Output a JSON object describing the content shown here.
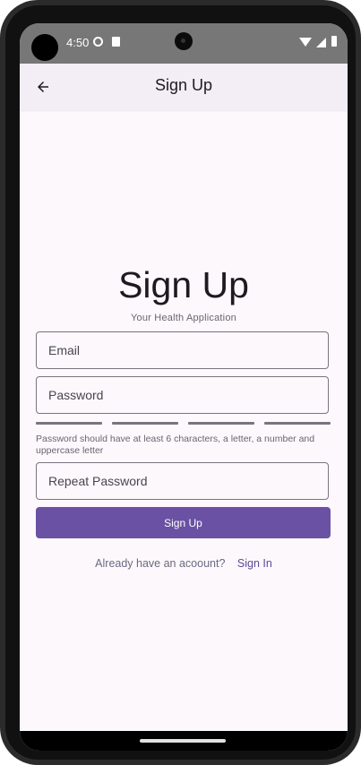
{
  "status_bar": {
    "time": "4:50",
    "icons": [
      "settings-icon",
      "sd-card-icon",
      "wifi-icon",
      "signal-icon",
      "battery-icon"
    ]
  },
  "app_bar": {
    "back_icon": "arrow-back-icon",
    "title": "Sign Up"
  },
  "form": {
    "heading": "Sign Up",
    "subtitle": "Your Health Application",
    "email_placeholder": "Email",
    "password_placeholder": "Password",
    "password_strength_segments": 4,
    "password_hint": "Password should have at least 6 characters, a letter, a number and uppercase letter",
    "repeat_password_placeholder": "Repeat Password",
    "submit_label": "Sign Up",
    "signin_prompt": "Already have an acoount?",
    "signin_link": "Sign In"
  },
  "colors": {
    "primary": "#6a51a3",
    "appbar_bg": "#f3edf6",
    "screen_bg": "#fdf8fc",
    "outline": "#79747e"
  }
}
